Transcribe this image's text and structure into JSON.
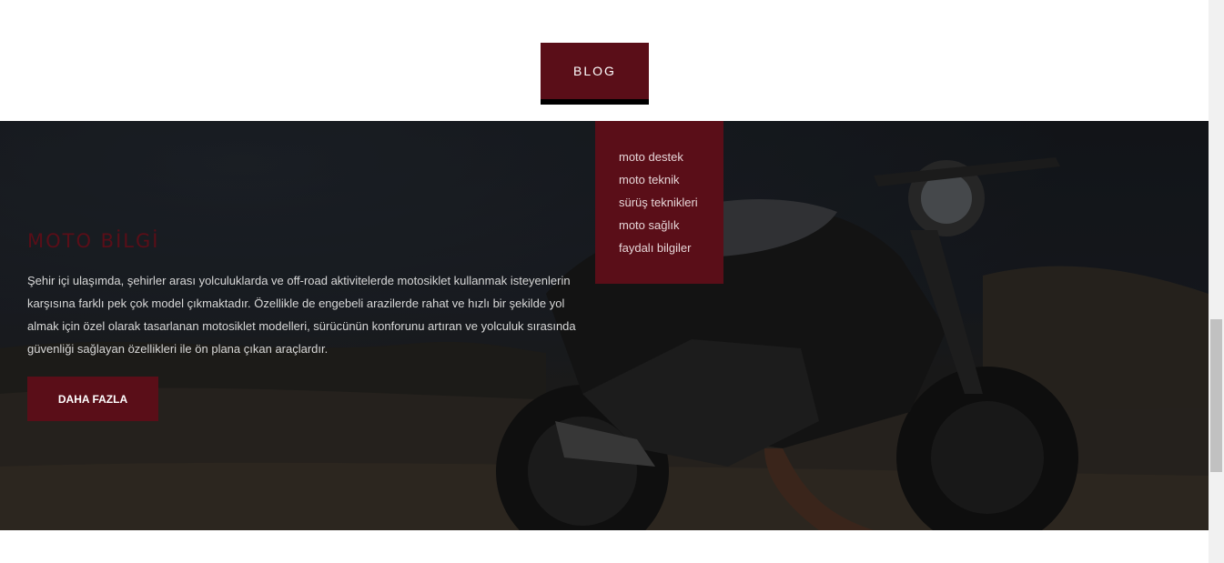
{
  "nav": {
    "blog_label": "BLOG"
  },
  "dropdown": {
    "items": [
      {
        "label": "moto destek"
      },
      {
        "label": "moto teknik"
      },
      {
        "label": "sürüş teknikleri"
      },
      {
        "label": "moto sağlık"
      },
      {
        "label": "faydalı bilgiler"
      }
    ]
  },
  "hero": {
    "title": "MOTO BİLGİ",
    "description": "Şehir içi ulaşımda, şehirler arası yolculuklarda ve off-road aktivitelerde motosiklet kullanmak isteyenlerin karşısına farklı pek çok model çıkmaktadır. Özellikle de engebeli arazilerde rahat ve hızlı bir şekilde yol almak için özel olarak tasarlanan motosiklet modelleri, sürücünün konforunu artıran ve yolculuk sırasında güvenliği sağlayan özellikleri ile ön plana çıkan araçlardır.",
    "button_label": "DAHA FAZLA",
    "image": "motorcycle-photo"
  },
  "colors": {
    "accent": "#5a0e18",
    "button_border": "#000000"
  }
}
